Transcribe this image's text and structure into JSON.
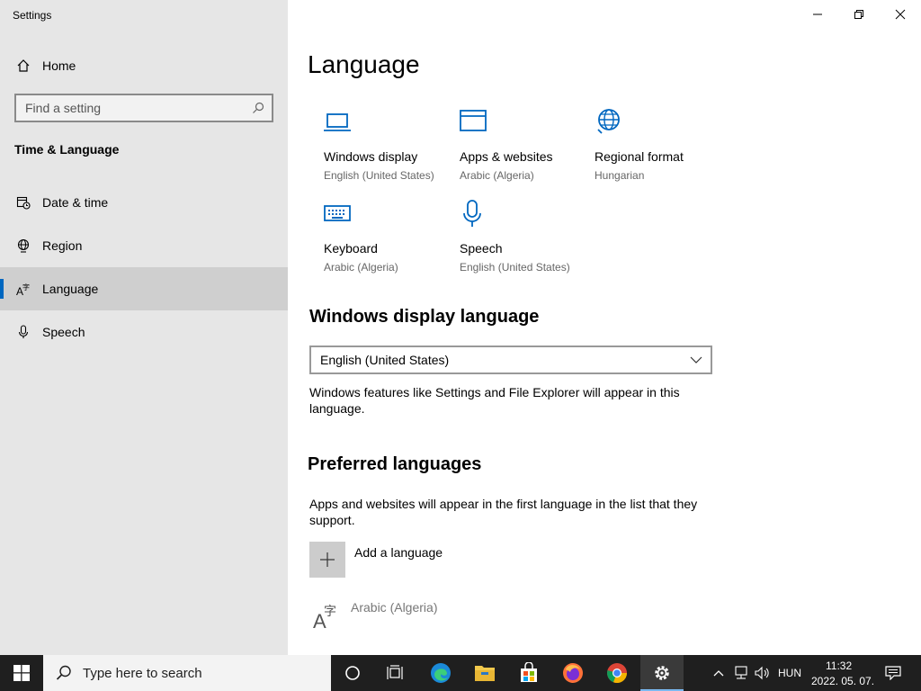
{
  "window": {
    "title": "Settings",
    "controls": [
      "minimize",
      "restore",
      "close"
    ]
  },
  "sidebar": {
    "home_label": "Home",
    "search_placeholder": "Find a setting",
    "section_title": "Time & Language",
    "items": [
      {
        "label": "Date & time",
        "icon": "calendar-clock-icon"
      },
      {
        "label": "Region",
        "icon": "globe-icon"
      },
      {
        "label": "Language",
        "icon": "language-icon",
        "selected": true
      },
      {
        "label": "Speech",
        "icon": "microphone-icon"
      }
    ]
  },
  "main": {
    "title": "Language",
    "tiles": [
      {
        "name": "Windows display",
        "sub": "English (United States)",
        "icon": "laptop-icon"
      },
      {
        "name": "Apps & websites",
        "sub": "Arabic (Algeria)",
        "icon": "browser-window-icon"
      },
      {
        "name": "Regional format",
        "sub": "Hungarian",
        "icon": "globe-icon"
      },
      {
        "name": "Keyboard",
        "sub": "Arabic (Algeria)",
        "icon": "keyboard-icon"
      },
      {
        "name": "Speech",
        "sub": "English (United States)",
        "icon": "microphone-icon"
      }
    ],
    "display_language": {
      "heading": "Windows display language",
      "selected": "English (United States)",
      "description": "Windows features like Settings and File Explorer will appear in this language."
    },
    "preferred": {
      "heading": "Preferred languages",
      "description": "Apps and websites will appear in the first language in the list that they support.",
      "add_label": "Add a language",
      "languages": [
        "Arabic (Algeria)"
      ]
    }
  },
  "taskbar": {
    "search_placeholder": "Type here to search",
    "apps": [
      "task-view",
      "edge",
      "file-explorer",
      "store",
      "firefox",
      "chrome",
      "settings"
    ],
    "language_indicator": "HUN",
    "time": "11:32",
    "date": "2022. 05. 07."
  },
  "colors": {
    "accent": "#0067c0",
    "sidebar_bg": "#e6e6e6",
    "taskbar_bg": "#1f1f1f"
  }
}
